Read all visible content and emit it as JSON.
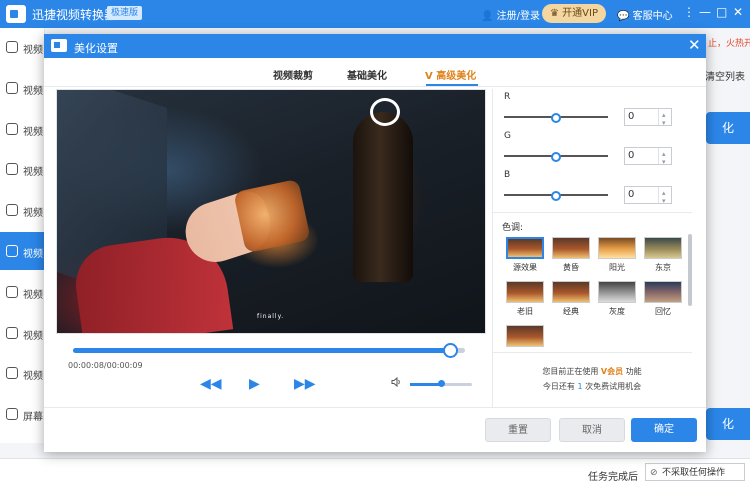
{
  "app": {
    "title": "迅捷视频转换器",
    "badge": "极速版",
    "login": "注册/登录",
    "vip_button": "开通VIP",
    "service": "客服中心",
    "win_controls": [
      "⋮",
      "—",
      "□",
      "✕"
    ]
  },
  "sidebar": {
    "items": [
      {
        "label": "视频",
        "icon": "video-convert-icon"
      },
      {
        "label": "视频",
        "icon": "video-split-icon"
      },
      {
        "label": "视频",
        "icon": "video-play-icon"
      },
      {
        "label": "视频",
        "icon": "gif-icon"
      },
      {
        "label": "视频",
        "icon": "download-icon"
      },
      {
        "label": "视频",
        "icon": "film-icon",
        "active": true
      },
      {
        "label": "视频",
        "icon": "image-icon"
      },
      {
        "label": "视频",
        "icon": "music-icon"
      },
      {
        "label": "视频",
        "icon": "arrows-icon"
      },
      {
        "label": "屏幕",
        "icon": "screen-record-icon"
      }
    ]
  },
  "main": {
    "right_hint": "止，火热开抢",
    "clear_list": "清空列表",
    "convert_top": "化",
    "convert_bottom": "化",
    "task_label": "任务完成后",
    "task_select": "不采取任何操作"
  },
  "dialog": {
    "title": "美化设置",
    "close": "✕",
    "tabs": [
      {
        "label": "视频裁剪",
        "active": false
      },
      {
        "label": "基础美化",
        "active": false
      },
      {
        "label": "高级美化",
        "active": true
      }
    ],
    "video": {
      "watermark": "finally.",
      "progress_fraction": 0.96,
      "time": "00:00:08/00:00:09",
      "volume_fraction": 0.5,
      "controls": [
        "◀◀",
        "▶",
        "▶▶"
      ]
    },
    "rgb": [
      {
        "label": "R",
        "value": "0",
        "fraction": 0.5
      },
      {
        "label": "G",
        "value": "0",
        "fraction": 0.5
      },
      {
        "label": "B",
        "value": "0",
        "fraction": 0.5
      }
    ],
    "tone_title": "色调:",
    "tones": [
      "源效果",
      "黄昏",
      "阳光",
      "东京",
      "老旧",
      "经典",
      "灰度",
      "回忆"
    ],
    "vip_notice": {
      "line1_prefix": "您目前正在使用",
      "line1_vip": "会员",
      "line1_suffix": "功能",
      "line2_prefix": "今日还有",
      "line2_count": "1",
      "line2_suffix": "次免费试用机会"
    },
    "buttons": {
      "reset": "重置",
      "cancel": "取消",
      "confirm": "确定"
    }
  },
  "colors": {
    "accent": "#2b86e8",
    "vip": "#e0821a",
    "danger": "#e8462c"
  }
}
